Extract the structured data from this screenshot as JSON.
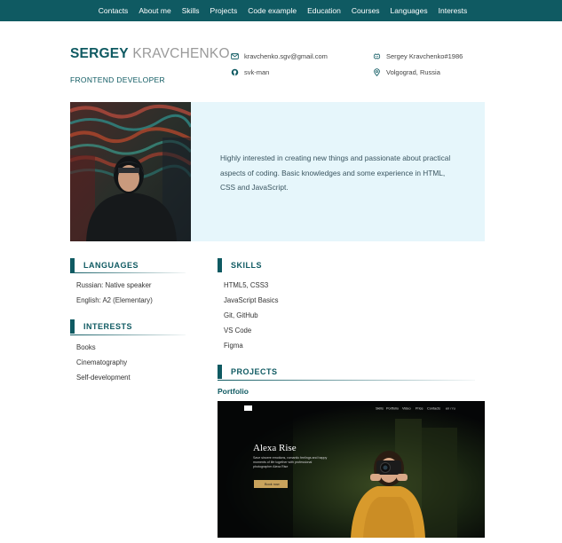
{
  "nav": {
    "items": [
      "Contacts",
      "About me",
      "Skills",
      "Projects",
      "Code example",
      "Education",
      "Courses",
      "Languages",
      "Interests"
    ]
  },
  "header": {
    "first_name": "SERGEY",
    "last_name": "KRAVCHENKO",
    "role": "FRONTEND DEVELOPER",
    "contacts": {
      "email": "kravchenko.sgv@gmail.com",
      "github": "svk-man",
      "discord": "Sergey Kravchenko#1986",
      "location": "Volgograd, Russia"
    }
  },
  "about": {
    "text": "Highly interested in creating new things and passionate about practical aspects of coding. Basic knowledges and some experience in HTML, CSS and JavaScript."
  },
  "languages": {
    "title": "LANGUAGES",
    "items": [
      "Russian: Native speaker",
      "English: A2 (Elementary)"
    ]
  },
  "interests": {
    "title": "INTERESTS",
    "items": [
      "Books",
      "Cinematography",
      "Self-development"
    ]
  },
  "skills": {
    "title": "SKILLS",
    "items": [
      "HTML5, CSS3",
      "JavaScript Basics",
      "Git, GitHub",
      "VS Code",
      "Figma"
    ]
  },
  "projects": {
    "title": "PROJECTS",
    "portfolio_label": "Portfolio",
    "preview": {
      "nav_items": [
        "Skills",
        "Portfolio",
        "Video",
        "Price",
        "Contacts",
        "en / ru"
      ],
      "heading": "Alexa Rise",
      "description": "Save sincere emotions, romantic feelings and happy moments of life together with professional photographer Alexa Rise",
      "button": "Book now"
    }
  },
  "colors": {
    "accent": "#0f5a62",
    "hero_bg": "#e6f6fb",
    "button_gold": "#c9a35c"
  }
}
